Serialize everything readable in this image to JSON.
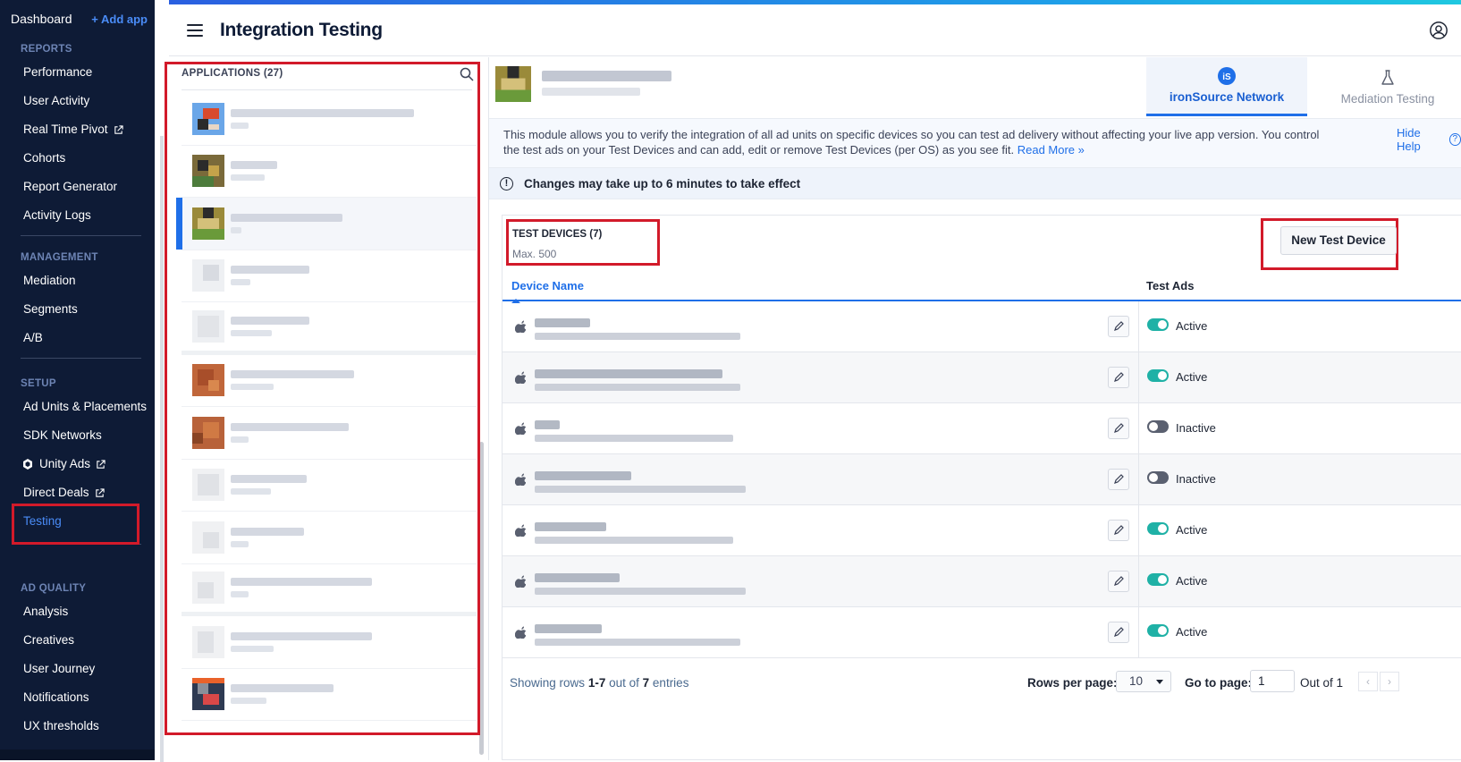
{
  "nav": {
    "dashboard": "Dashboard",
    "add_app": "+ Add app",
    "sections": [
      {
        "title": "REPORTS",
        "items": [
          "Performance",
          "User Activity",
          "Real Time Pivot",
          "Cohorts",
          "Report Generator",
          "Activity Logs"
        ]
      },
      {
        "title": "MANAGEMENT",
        "items": [
          "Mediation",
          "Segments",
          "A/B"
        ]
      },
      {
        "title": "SETUP",
        "items": [
          "Ad Units & Placements",
          "SDK Networks",
          "Unity Ads",
          "Direct Deals",
          "Testing"
        ]
      },
      {
        "title": "AD QUALITY",
        "items": [
          "Analysis",
          "Creatives",
          "User Journey",
          "Notifications",
          "UX thresholds"
        ]
      }
    ],
    "active": "Testing"
  },
  "header": {
    "title": "Integration Testing"
  },
  "apps_panel": {
    "title": "APPLICATIONS (27)"
  },
  "tabs": [
    {
      "label": "ironSource Network",
      "active": true,
      "icon": "ironsource-logo-icon"
    },
    {
      "label": "Mediation Testing",
      "active": false,
      "icon": "flask-icon"
    }
  ],
  "help": {
    "text": "This module allows you to verify the integration of all ad units on specific devices so you can test ad delivery without affecting your live app version. You control the test ads on your Test Devices and can add, edit or remove Test Devices (per OS) as you see fit.",
    "read_more": "Read More »",
    "hide": "Hide Help"
  },
  "notice": "Changes may take up to 6 minutes to take effect",
  "devices": {
    "title": "TEST DEVICES (7)",
    "max": "Max. 500",
    "new_button": "New Test Device",
    "col_name": "Device Name",
    "col_ads": "Test Ads",
    "rows": [
      {
        "status": "Active",
        "on": true
      },
      {
        "status": "Active",
        "on": true
      },
      {
        "status": "Inactive",
        "on": false
      },
      {
        "status": "Inactive",
        "on": false
      },
      {
        "status": "Active",
        "on": true
      },
      {
        "status": "Active",
        "on": true
      },
      {
        "status": "Active",
        "on": true
      }
    ]
  },
  "pagination": {
    "showing_prefix": "Showing rows",
    "range": "1-7",
    "out_of": "out of",
    "total": "7",
    "entries": "entries",
    "rows_per_page_label": "Rows per page:",
    "rows_per_page": "10",
    "go_to_label": "Go to page:",
    "page": "1",
    "page_of": "Out of 1"
  },
  "colors": {
    "accent": "#1f6fe8",
    "nav_bg": "#0e1b36",
    "toggle_on": "#1fb1a6",
    "highlight": "#d21a2a"
  }
}
